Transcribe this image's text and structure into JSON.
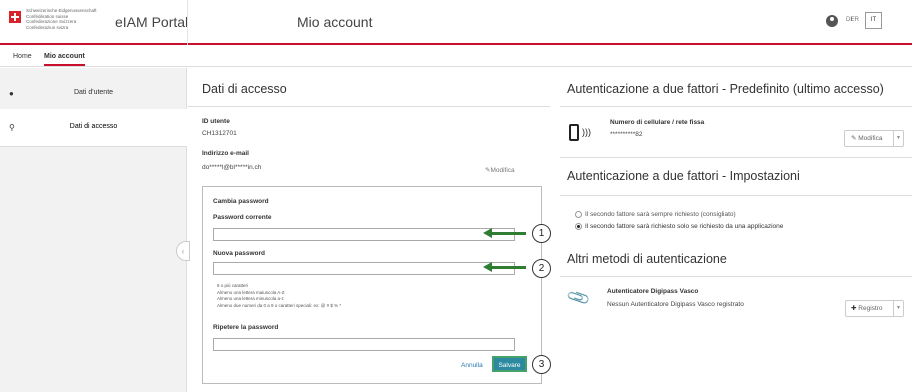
{
  "header": {
    "confederation_lines": [
      "Schweizerische Eidgenossenschaft",
      "Confédération suisse",
      "Confederazione Svizzera",
      "Confederaziun svizra"
    ],
    "app_title": "eIAM Portal",
    "page_title": "Mio account",
    "languages": [
      "DE",
      "FR",
      "IT"
    ],
    "active_language": "IT"
  },
  "tabs": {
    "home": "Home",
    "account": "Mio account"
  },
  "sidebar": {
    "items": [
      {
        "label": "Dati d'utente",
        "icon": "user-icon"
      },
      {
        "label": "Dati di accesso",
        "icon": "key-icon"
      }
    ]
  },
  "access": {
    "title": "Dati di accesso",
    "user_id_label": "ID utente",
    "user_id_value": "CH1312701",
    "email_label": "Indirizzo e-mail",
    "email_value": "do*****l@bl*****in.ch",
    "edit_link": "Modifica"
  },
  "password": {
    "title": "Cambia password",
    "current_label": "Password corrente",
    "new_label": "Nuova password",
    "rules": [
      "8 o più caratteri",
      "Almeno una lettera maiuscola A-Z",
      "Almeno una lettera minuscola a-z",
      "Almeno due numeri da 0 a 9 o caratteri speciali: ex: @ # $ % *"
    ],
    "repeat_label": "Ripetere la password",
    "cancel": "Annulla",
    "save": "Salvare"
  },
  "callouts": [
    "1",
    "2",
    "3"
  ],
  "twofa_default": {
    "title": "Autenticazione a due fattori - Predefinito (ultimo accesso)",
    "method_label": "Numero di cellulare / rete fissa",
    "method_value": "**********82",
    "edit_button": "Modifica"
  },
  "twofa_settings": {
    "title": "Autenticazione a due fattori - Impostazioni",
    "options": [
      {
        "label": "Il secondo fattore sarà sempre richiesto (consigliato)",
        "selected": false
      },
      {
        "label": "Il secondo fattore sarà richiesto solo se richiesto da una applicazione",
        "selected": true
      }
    ]
  },
  "other_methods": {
    "title": "Altri metodi di autenticazione",
    "method_label": "Autenticatore Digipass Vasco",
    "method_desc": "Nessun Autenticatore Digipass Vasco registrato",
    "register_button": "Registro"
  },
  "colors": {
    "brand_red": "#c8102e",
    "arrow_green": "#2e7d32",
    "save_button": "#2c8aa0"
  }
}
